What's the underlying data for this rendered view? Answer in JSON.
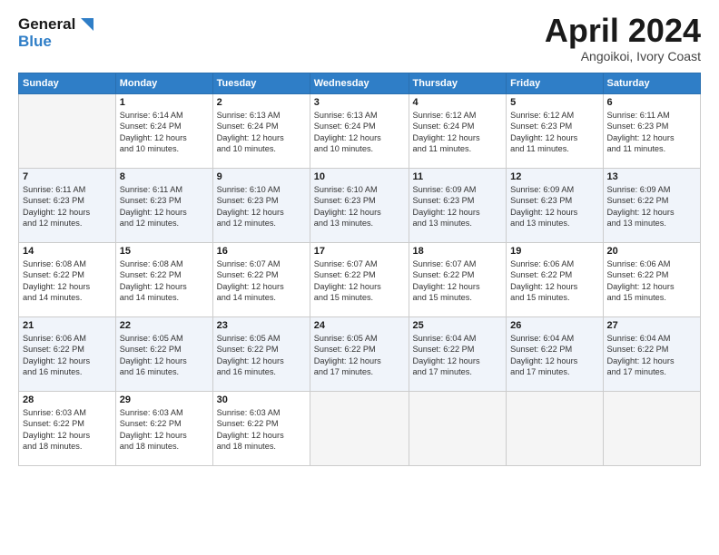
{
  "header": {
    "logo_line1": "General",
    "logo_line2": "Blue",
    "month_title": "April 2024",
    "location": "Angoikoi, Ivory Coast"
  },
  "days_of_week": [
    "Sunday",
    "Monday",
    "Tuesday",
    "Wednesday",
    "Thursday",
    "Friday",
    "Saturday"
  ],
  "weeks": [
    [
      {
        "num": "",
        "info": ""
      },
      {
        "num": "1",
        "info": "Sunrise: 6:14 AM\nSunset: 6:24 PM\nDaylight: 12 hours\nand 10 minutes."
      },
      {
        "num": "2",
        "info": "Sunrise: 6:13 AM\nSunset: 6:24 PM\nDaylight: 12 hours\nand 10 minutes."
      },
      {
        "num": "3",
        "info": "Sunrise: 6:13 AM\nSunset: 6:24 PM\nDaylight: 12 hours\nand 10 minutes."
      },
      {
        "num": "4",
        "info": "Sunrise: 6:12 AM\nSunset: 6:24 PM\nDaylight: 12 hours\nand 11 minutes."
      },
      {
        "num": "5",
        "info": "Sunrise: 6:12 AM\nSunset: 6:23 PM\nDaylight: 12 hours\nand 11 minutes."
      },
      {
        "num": "6",
        "info": "Sunrise: 6:11 AM\nSunset: 6:23 PM\nDaylight: 12 hours\nand 11 minutes."
      }
    ],
    [
      {
        "num": "7",
        "info": "Sunrise: 6:11 AM\nSunset: 6:23 PM\nDaylight: 12 hours\nand 12 minutes."
      },
      {
        "num": "8",
        "info": "Sunrise: 6:11 AM\nSunset: 6:23 PM\nDaylight: 12 hours\nand 12 minutes."
      },
      {
        "num": "9",
        "info": "Sunrise: 6:10 AM\nSunset: 6:23 PM\nDaylight: 12 hours\nand 12 minutes."
      },
      {
        "num": "10",
        "info": "Sunrise: 6:10 AM\nSunset: 6:23 PM\nDaylight: 12 hours\nand 13 minutes."
      },
      {
        "num": "11",
        "info": "Sunrise: 6:09 AM\nSunset: 6:23 PM\nDaylight: 12 hours\nand 13 minutes."
      },
      {
        "num": "12",
        "info": "Sunrise: 6:09 AM\nSunset: 6:23 PM\nDaylight: 12 hours\nand 13 minutes."
      },
      {
        "num": "13",
        "info": "Sunrise: 6:09 AM\nSunset: 6:22 PM\nDaylight: 12 hours\nand 13 minutes."
      }
    ],
    [
      {
        "num": "14",
        "info": "Sunrise: 6:08 AM\nSunset: 6:22 PM\nDaylight: 12 hours\nand 14 minutes."
      },
      {
        "num": "15",
        "info": "Sunrise: 6:08 AM\nSunset: 6:22 PM\nDaylight: 12 hours\nand 14 minutes."
      },
      {
        "num": "16",
        "info": "Sunrise: 6:07 AM\nSunset: 6:22 PM\nDaylight: 12 hours\nand 14 minutes."
      },
      {
        "num": "17",
        "info": "Sunrise: 6:07 AM\nSunset: 6:22 PM\nDaylight: 12 hours\nand 15 minutes."
      },
      {
        "num": "18",
        "info": "Sunrise: 6:07 AM\nSunset: 6:22 PM\nDaylight: 12 hours\nand 15 minutes."
      },
      {
        "num": "19",
        "info": "Sunrise: 6:06 AM\nSunset: 6:22 PM\nDaylight: 12 hours\nand 15 minutes."
      },
      {
        "num": "20",
        "info": "Sunrise: 6:06 AM\nSunset: 6:22 PM\nDaylight: 12 hours\nand 15 minutes."
      }
    ],
    [
      {
        "num": "21",
        "info": "Sunrise: 6:06 AM\nSunset: 6:22 PM\nDaylight: 12 hours\nand 16 minutes."
      },
      {
        "num": "22",
        "info": "Sunrise: 6:05 AM\nSunset: 6:22 PM\nDaylight: 12 hours\nand 16 minutes."
      },
      {
        "num": "23",
        "info": "Sunrise: 6:05 AM\nSunset: 6:22 PM\nDaylight: 12 hours\nand 16 minutes."
      },
      {
        "num": "24",
        "info": "Sunrise: 6:05 AM\nSunset: 6:22 PM\nDaylight: 12 hours\nand 17 minutes."
      },
      {
        "num": "25",
        "info": "Sunrise: 6:04 AM\nSunset: 6:22 PM\nDaylight: 12 hours\nand 17 minutes."
      },
      {
        "num": "26",
        "info": "Sunrise: 6:04 AM\nSunset: 6:22 PM\nDaylight: 12 hours\nand 17 minutes."
      },
      {
        "num": "27",
        "info": "Sunrise: 6:04 AM\nSunset: 6:22 PM\nDaylight: 12 hours\nand 17 minutes."
      }
    ],
    [
      {
        "num": "28",
        "info": "Sunrise: 6:03 AM\nSunset: 6:22 PM\nDaylight: 12 hours\nand 18 minutes."
      },
      {
        "num": "29",
        "info": "Sunrise: 6:03 AM\nSunset: 6:22 PM\nDaylight: 12 hours\nand 18 minutes."
      },
      {
        "num": "30",
        "info": "Sunrise: 6:03 AM\nSunset: 6:22 PM\nDaylight: 12 hours\nand 18 minutes."
      },
      {
        "num": "",
        "info": ""
      },
      {
        "num": "",
        "info": ""
      },
      {
        "num": "",
        "info": ""
      },
      {
        "num": "",
        "info": ""
      }
    ]
  ]
}
